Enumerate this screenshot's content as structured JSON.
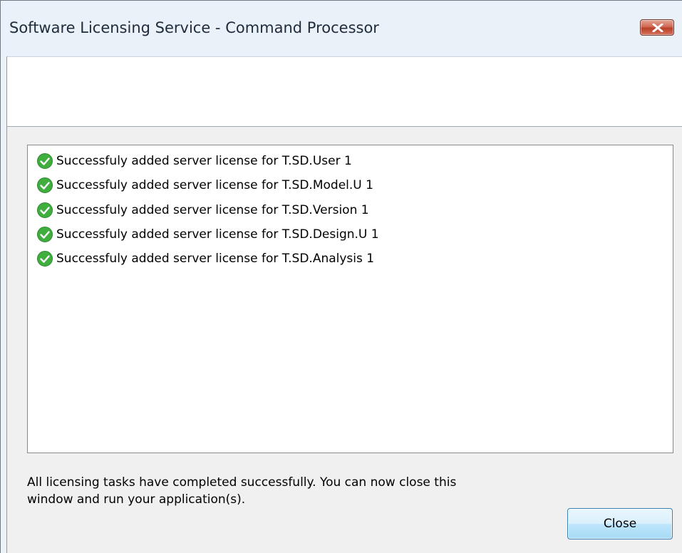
{
  "window": {
    "title": "Software Licensing Service - Command Processor",
    "close_icon": "close-icon"
  },
  "results": {
    "icon": "check-circle-icon",
    "icon_color": "#3fae3f",
    "items": [
      "Successfuly added server license for T.SD.User 1",
      "Successfuly added server license for T.SD.Model.U 1",
      "Successfuly added server license for T.SD.Version 1",
      "Successfuly added server license for T.SD.Design.U 1",
      "Successfuly added server license for T.SD.Analysis 1"
    ]
  },
  "status": {
    "line1": "All licensing tasks have completed successfully. You can now close this",
    "line2": "window and run your application(s)."
  },
  "buttons": {
    "close_label": "Close"
  }
}
